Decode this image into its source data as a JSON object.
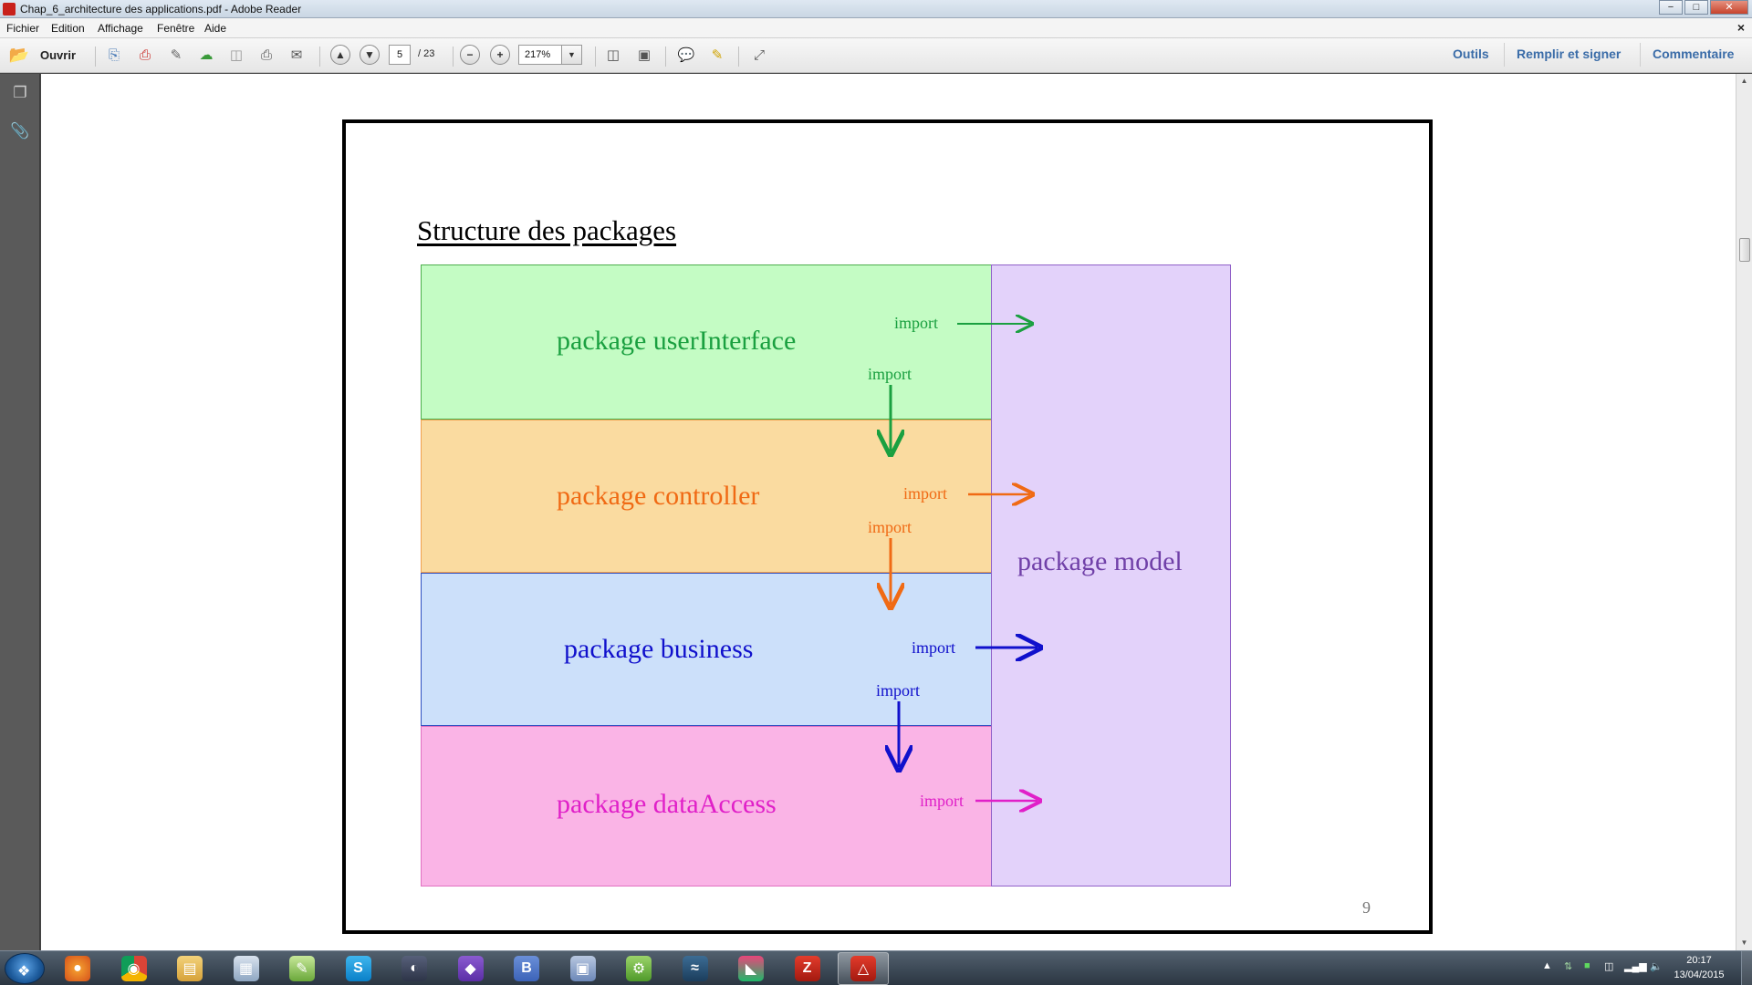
{
  "window": {
    "title": "Chap_6_architecture des applications.pdf - Adobe Reader",
    "controls": {
      "minimize": "−",
      "maximize": "□",
      "close": "✕"
    }
  },
  "menu": {
    "items": [
      "Fichier",
      "Edition",
      "Affichage",
      "Fenêtre",
      "Aide"
    ],
    "close_doc": "×"
  },
  "toolbar": {
    "open_label": "Ouvrir",
    "page_current": "5",
    "page_total": "/ 23",
    "zoom": "217%",
    "right_links": [
      "Outils",
      "Remplir et signer",
      "Commentaire"
    ]
  },
  "slide": {
    "title": "Structure des packages",
    "page_number": "9",
    "packages": [
      {
        "label": "package userInterface",
        "color": "#1aa040",
        "bg": "#c4fcc4"
      },
      {
        "label": "package controller",
        "color": "#f06a14",
        "bg": "#fadba0"
      },
      {
        "label": "package business",
        "color": "#1010cc",
        "bg": "#cce0fa"
      },
      {
        "label": "package dataAccess",
        "color": "#e020c8",
        "bg": "#fab4e6"
      }
    ],
    "model": {
      "label": "package model",
      "color": "#7040a8",
      "bg": "#e3d2fa"
    },
    "import_label": "import"
  },
  "taskbar": {
    "apps": [
      "firefox",
      "chrome",
      "file-explorer",
      "calculator",
      "notepad-plus",
      "skype",
      "eclipse",
      "visual-studio",
      "bootstrap",
      "virtualbox",
      "android-studio",
      "mysql-workbench",
      "jetbrains",
      "filezilla",
      "adobe-reader"
    ],
    "active_app": "adobe-reader",
    "time": "20:17",
    "date": "13/04/2015"
  }
}
